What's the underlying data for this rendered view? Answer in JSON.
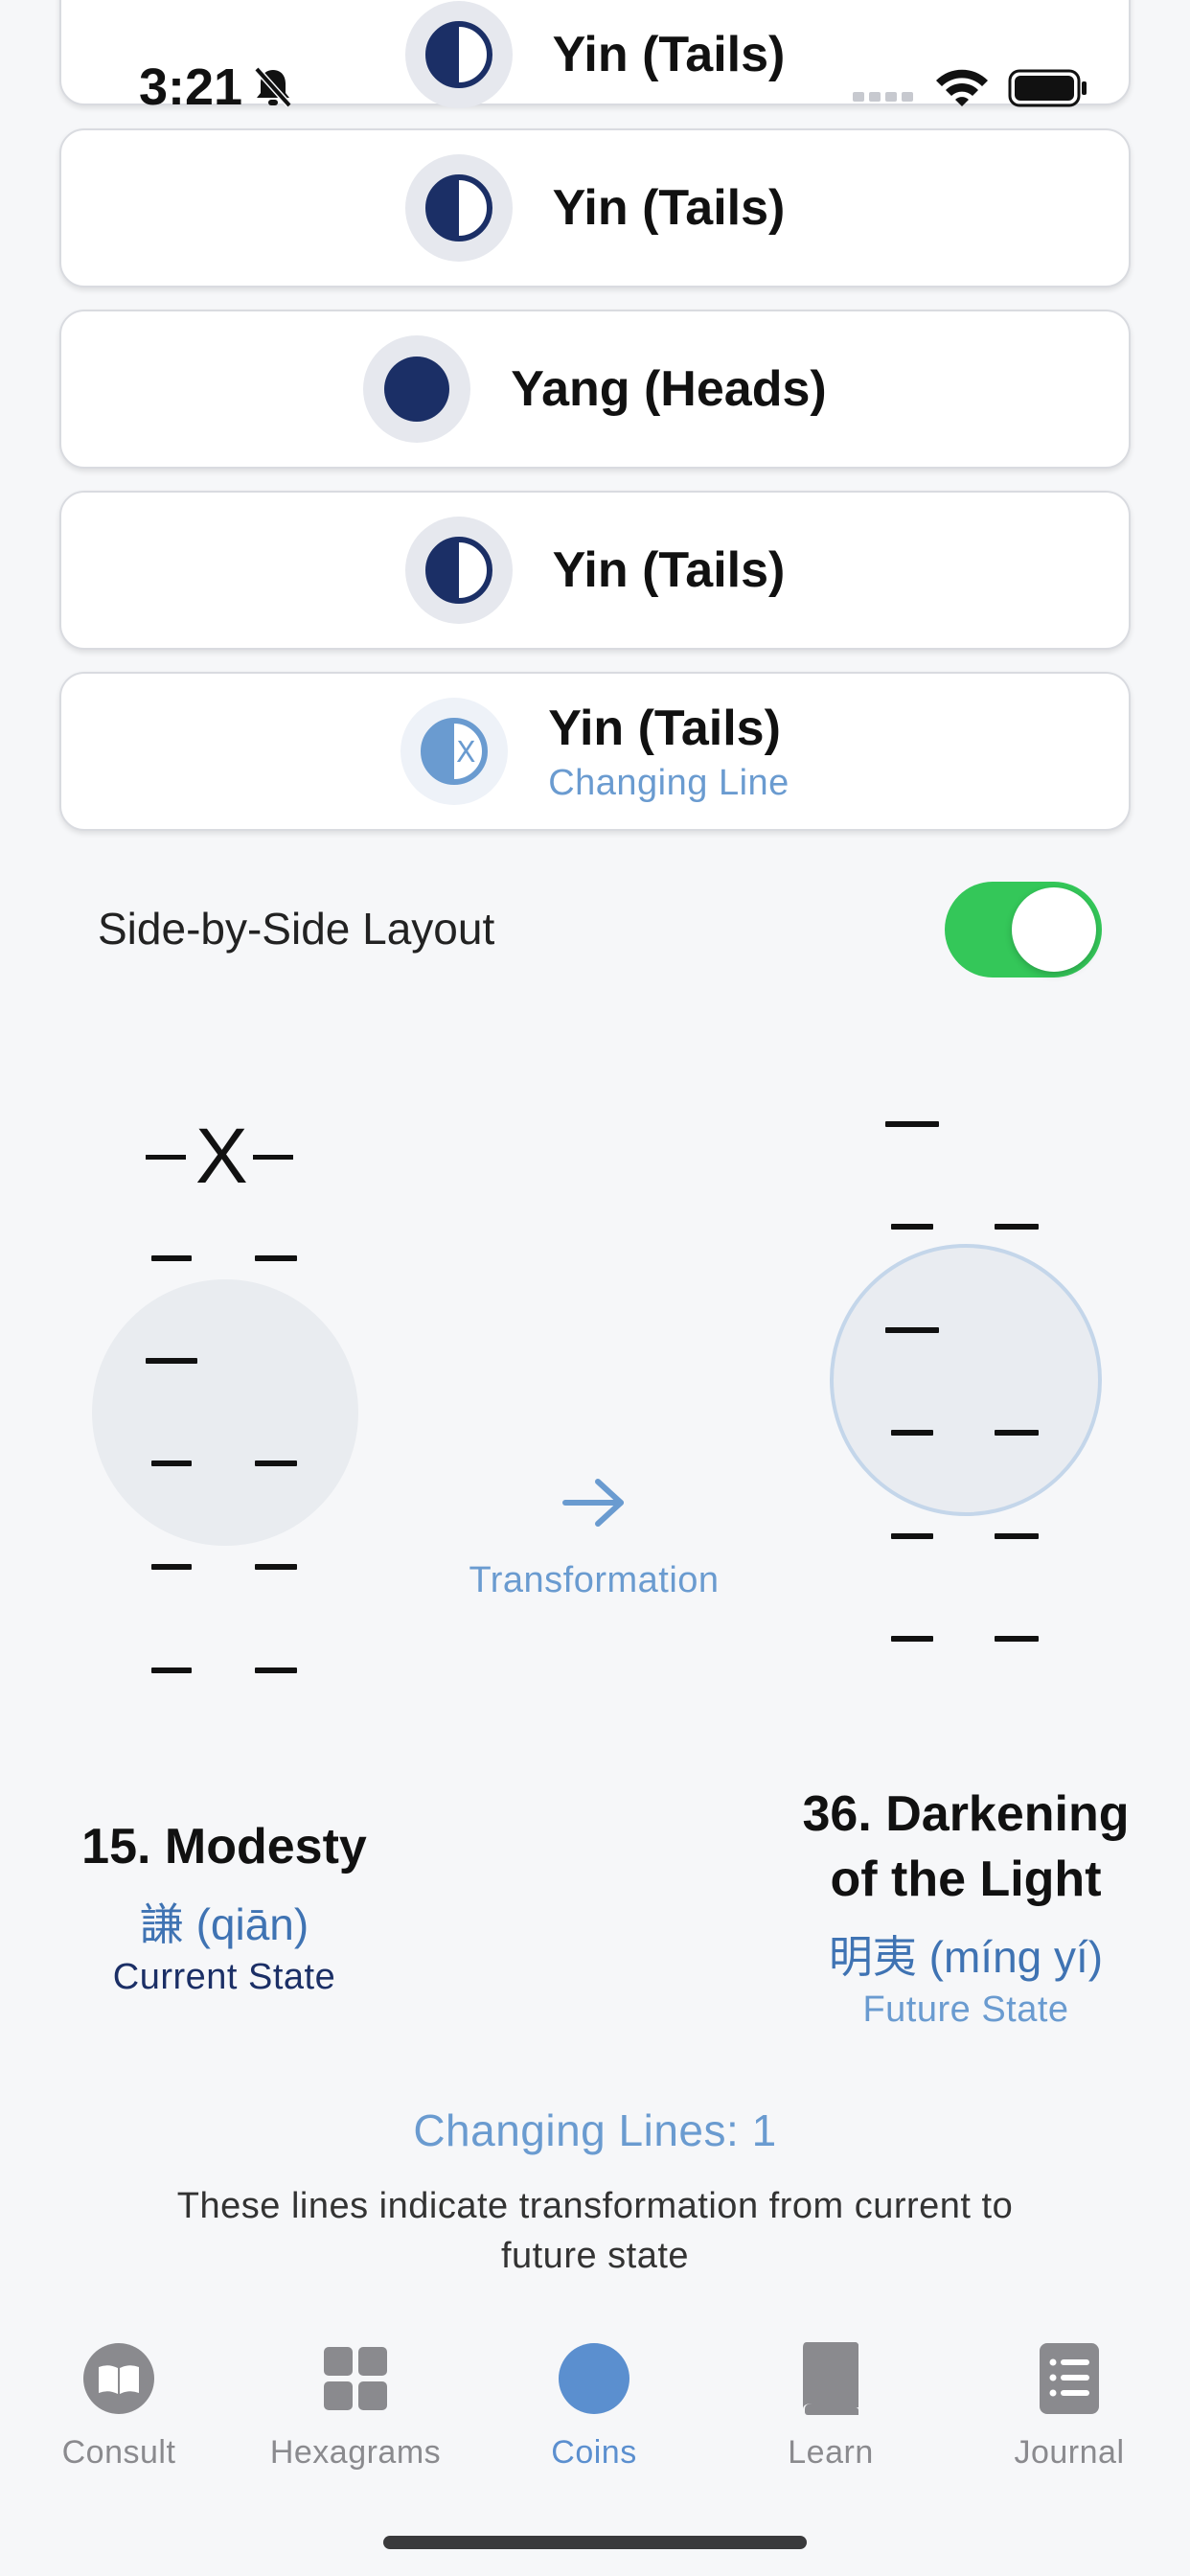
{
  "status_bar": {
    "time": "3:21"
  },
  "coin_results": [
    {
      "label": "Yin (Tails)",
      "icon": "half-moon-coin-icon",
      "changing": false
    },
    {
      "label": "Yin (Tails)",
      "icon": "half-moon-coin-icon",
      "changing": false
    },
    {
      "label": "Yang (Heads)",
      "icon": "full-coin-icon",
      "changing": false
    },
    {
      "label": "Yin (Tails)",
      "icon": "half-moon-coin-icon",
      "changing": false
    },
    {
      "label": "Yin (Tails)",
      "sublabel": "Changing Line",
      "icon": "changing-coin-icon",
      "changing": true
    }
  ],
  "layout_toggle": {
    "label": "Side-by-Side Layout",
    "on": true
  },
  "transformation": {
    "label": "Transformation"
  },
  "current_hexagram": {
    "title": "15. Modesty",
    "chinese": "謙 (qiān)",
    "state": "Current State"
  },
  "future_hexagram": {
    "title_line1": "36. Darkening",
    "title_line2": "of the Light",
    "chinese": "明夷 (míng yí)",
    "state": "Future State"
  },
  "changing_lines": {
    "count_text": "Changing Lines: 1",
    "description": "These lines indicate transformation from current to future state"
  },
  "tabs": [
    {
      "label": "Consult",
      "icon": "open-book-icon",
      "active": false
    },
    {
      "label": "Hexagrams",
      "icon": "grid-icon",
      "active": false
    },
    {
      "label": "Coins",
      "icon": "coin-icon",
      "active": true
    },
    {
      "label": "Learn",
      "icon": "book-icon",
      "active": false
    },
    {
      "label": "Journal",
      "icon": "list-icon",
      "active": false
    }
  ],
  "colors": {
    "navy": "#1b2f66",
    "accent": "#6a9bd0",
    "toggle_on": "#34c759",
    "tab_active": "#5b8fcf",
    "tab_inactive": "#8a8a8e"
  }
}
